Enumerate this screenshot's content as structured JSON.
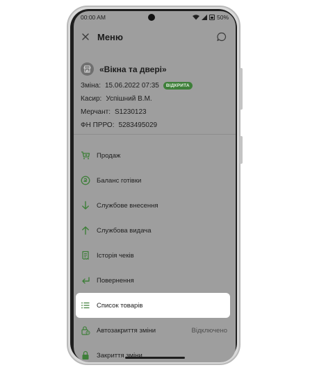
{
  "status": {
    "time": "00:00 AM",
    "battery": "50%"
  },
  "header": {
    "title": "Меню"
  },
  "shop": {
    "name": "«Вікна та двері»",
    "shift_label": "Зміна:",
    "shift_value": "15.06.2022 07:35",
    "shift_badge": "ВІДКРИТА",
    "cashier_label": "Касир:",
    "cashier_value": "Успішний В.М.",
    "merchant_label": "Мерчант:",
    "merchant_value": "S1230123",
    "prro_label": "ФН ПРРО:",
    "prro_value": "5283495029"
  },
  "menu": {
    "items": [
      {
        "label": "Продаж",
        "icon": "cart-icon"
      },
      {
        "label": "Баланс готівки",
        "icon": "coin-icon"
      },
      {
        "label": "Службове внесення",
        "icon": "arrow-down-icon"
      },
      {
        "label": "Службова видача",
        "icon": "arrow-up-icon"
      },
      {
        "label": "Історія чеків",
        "icon": "receipt-icon"
      },
      {
        "label": "Повернення",
        "icon": "return-icon"
      },
      {
        "label": "Список товарів",
        "icon": "list-icon"
      },
      {
        "label": "Автозакриття зміни",
        "icon": "auto-lock-icon",
        "value": "Відключено"
      },
      {
        "label": "Закриття зміни",
        "icon": "lock-icon"
      }
    ]
  },
  "colors": {
    "accent": "#3e7f39",
    "overlay": "#9e9e9e",
    "active_bg": "#ffffff"
  }
}
